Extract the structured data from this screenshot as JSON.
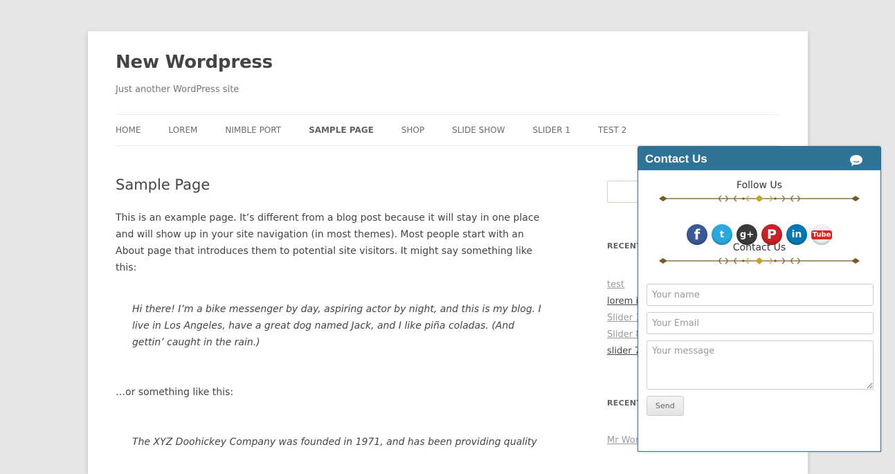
{
  "site": {
    "title": "New Wordpress",
    "description": "Just another WordPress site"
  },
  "nav": {
    "items": [
      {
        "label": "Home"
      },
      {
        "label": "Lorem"
      },
      {
        "label": "Nimble Port"
      },
      {
        "label": "Sample Page",
        "active": true
      },
      {
        "label": "Shop"
      },
      {
        "label": "Slide Show"
      },
      {
        "label": "Slider 1"
      },
      {
        "label": "Test 2"
      }
    ]
  },
  "main": {
    "title": "Sample Page",
    "intro": "This is an example page. It’s different from a blog post because it will stay in one place and will show up in your site navigation (in most themes). Most people start with an About page that introduces them to potential site visitors. It might say something like this:",
    "quote1": "Hi there! I’m a bike messenger by day, aspiring actor by night, and this is my blog. I live in Los Angeles, have a great dog named Jack, and I like piña coladas. (And gettin’ caught in the rain.)",
    "transition": "…or something like this:",
    "quote2": "The XYZ Doohickey Company was founded in 1971, and has been providing quality"
  },
  "sidebar": {
    "recent_posts_title": "Recent",
    "recent_posts": [
      "test",
      "lorem ip",
      "Slider 1",
      "Slider 8",
      "slider 7"
    ],
    "recent_comments_title": "Recent",
    "recent_comments": [
      "Mr Wor"
    ]
  },
  "contact": {
    "header": "Contact Us",
    "follow_title": "Follow Us",
    "contact_title": "Contact Us",
    "social": [
      {
        "icon": "facebook-icon",
        "glyph": "f"
      },
      {
        "icon": "twitter-icon",
        "glyph": "t"
      },
      {
        "icon": "google-plus-icon",
        "glyph": "g+"
      },
      {
        "icon": "pinterest-icon",
        "glyph": "P"
      },
      {
        "icon": "linkedin-icon",
        "glyph": "in"
      },
      {
        "icon": "youtube-icon",
        "glyph": "Tube"
      }
    ],
    "form": {
      "name_placeholder": "Your name",
      "email_placeholder": "Your Email",
      "message_placeholder": "Your message",
      "send_label": "Send"
    }
  },
  "colors": {
    "background": "#e6e6e6",
    "panel_header": "#2f7496",
    "divider_brown": "#7a5a1e",
    "divider_gold": "#c9a428"
  }
}
